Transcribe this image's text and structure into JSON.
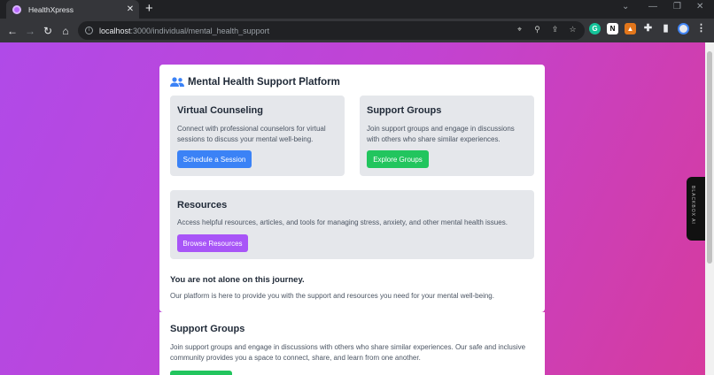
{
  "browser": {
    "tab_title": "HealthXpress",
    "tab_close": "✕",
    "new_tab": "+",
    "url_host": "localhost",
    "url_path": ":3000/individual/mental_health_support"
  },
  "platform": {
    "title": "Mental Health Support Platform"
  },
  "virtual_counseling": {
    "title": "Virtual Counseling",
    "desc": "Connect with professional counselors for virtual sessions to discuss your mental well-being.",
    "button": "Schedule a Session"
  },
  "support_groups_box": {
    "title": "Support Groups",
    "desc": "Join support groups and engage in discussions with others who share similar experiences.",
    "button": "Explore Groups"
  },
  "resources": {
    "title": "Resources",
    "desc": "Access helpful resources, articles, and tools for managing stress, anxiety, and other mental health issues.",
    "button": "Browse Resources"
  },
  "not_alone": {
    "title": "You are not alone on this journey.",
    "desc": "Our platform is here to provide you with the support and resources you need for your mental well-being."
  },
  "support_groups_section": {
    "title": "Support Groups",
    "desc": "Join support groups and engage in discussions with others who share similar experiences. Our safe and inclusive community provides you a space to connect, share, and learn from one another."
  },
  "side_widget": {
    "label": "BLACKBOX AI"
  },
  "colors": {
    "blue_button": "#3b82f6",
    "green_button": "#22c55e",
    "purple_button": "#a855f7"
  }
}
